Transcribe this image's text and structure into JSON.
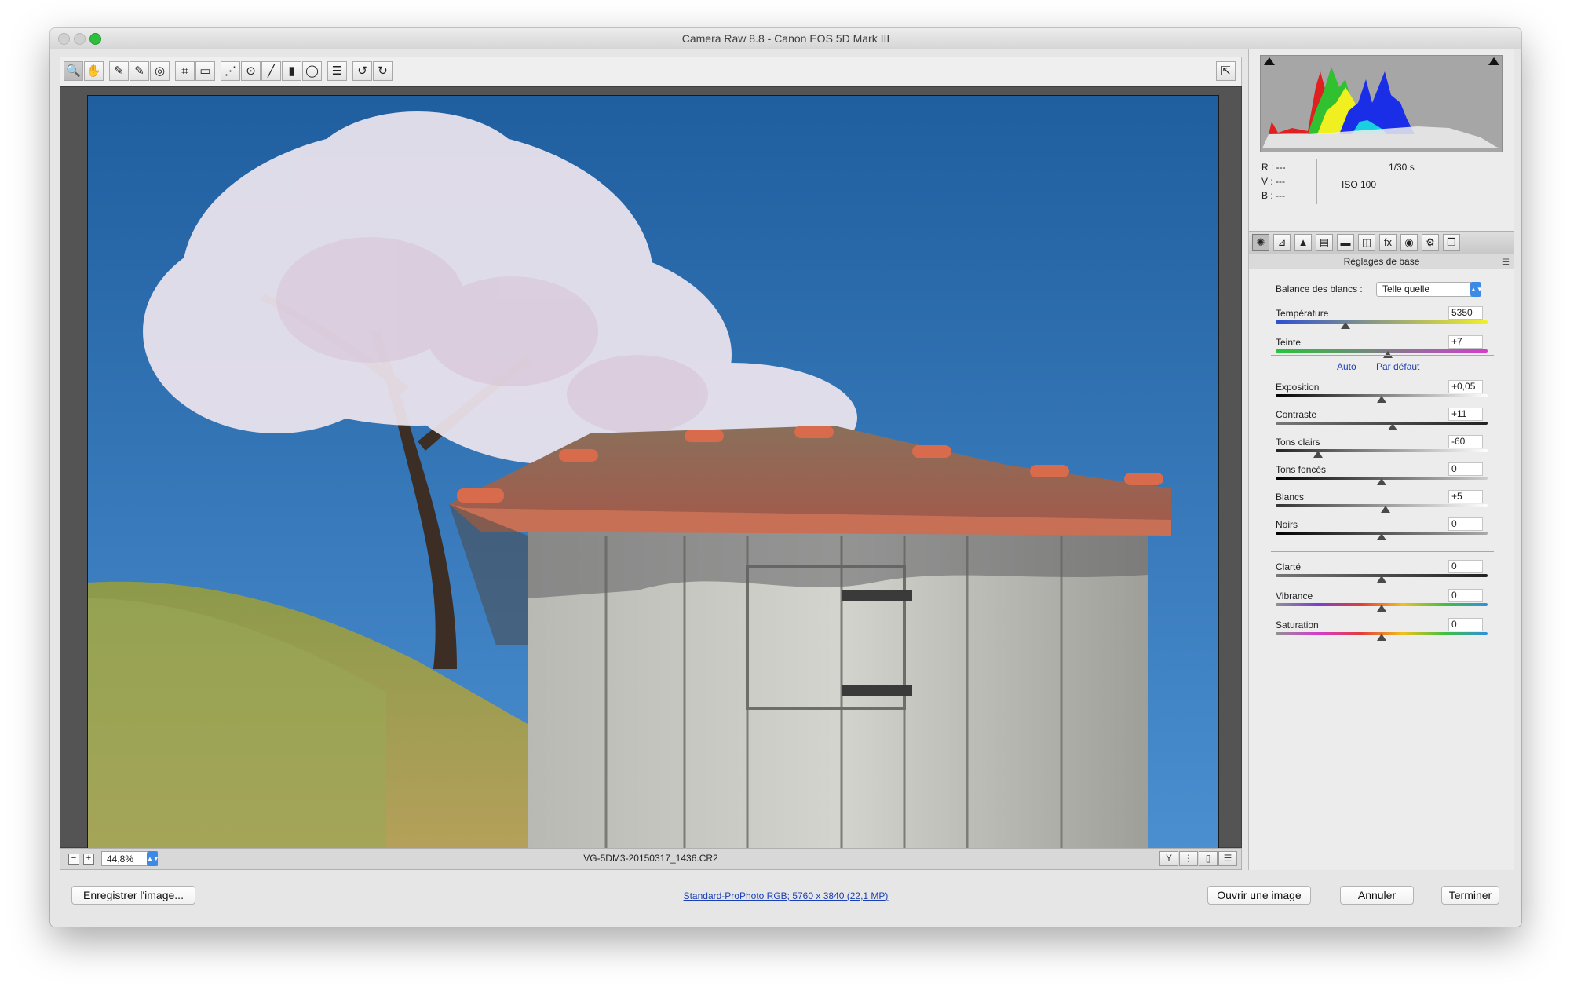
{
  "window": {
    "title": "Camera Raw 8.8  -  Canon EOS 5D Mark III"
  },
  "toolbar": {
    "tools": [
      {
        "name": "zoom-tool-icon",
        "glyph": "🔍"
      },
      {
        "name": "hand-tool-icon",
        "glyph": "✋"
      },
      {
        "name": "white-balance-tool-icon",
        "glyph": "✎"
      },
      {
        "name": "color-sampler-tool-icon",
        "glyph": "✎"
      },
      {
        "name": "targeted-adjustment-tool-icon",
        "glyph": "◎"
      },
      {
        "name": "crop-tool-icon",
        "glyph": "⌗"
      },
      {
        "name": "straighten-tool-icon",
        "glyph": "▭"
      },
      {
        "name": "spot-removal-tool-icon",
        "glyph": "⋰"
      },
      {
        "name": "red-eye-tool-icon",
        "glyph": "⊙"
      },
      {
        "name": "adjustment-brush-icon",
        "glyph": "╱"
      },
      {
        "name": "graduated-filter-icon",
        "glyph": "▮"
      },
      {
        "name": "radial-filter-icon",
        "glyph": "◯"
      },
      {
        "name": "preferences-icon",
        "glyph": "☰"
      },
      {
        "name": "rotate-left-icon",
        "glyph": "↺"
      },
      {
        "name": "rotate-right-icon",
        "glyph": "↻"
      }
    ],
    "fullscreen_icon": "⇱"
  },
  "statusbar": {
    "zoom_out": "−",
    "zoom_in": "+",
    "zoom_value": "44,8%",
    "filename": "VG-5DM3-20150317_1436.CR2",
    "view_tools": [
      "Y",
      "⋮",
      "▯",
      "☰"
    ]
  },
  "histogram": {
    "readout": {
      "r": "R :   ---",
      "v": "V :   ---",
      "b": "B :   ---"
    },
    "shutter": "1/30 s",
    "iso": "ISO 100"
  },
  "panel": {
    "tabs": [
      "✺",
      "⊿",
      "▲",
      "▤",
      "▬",
      "◫",
      "fx",
      "◉",
      "⚙",
      "❐"
    ],
    "section_title": "Réglages de base",
    "wb_label": "Balance des blancs :",
    "wb_value": "Telle quelle",
    "auto": "Auto",
    "default": "Par défaut",
    "sliders": [
      {
        "key": "temperature",
        "label": "Température",
        "value": "5350",
        "pos": 0.33
      },
      {
        "key": "teinte",
        "label": "Teinte",
        "value": "+7",
        "pos": 0.53
      },
      {
        "key": "exposition",
        "label": "Exposition",
        "value": "+0,05",
        "pos": 0.5
      },
      {
        "key": "contraste",
        "label": "Contraste",
        "value": "+11",
        "pos": 0.55
      },
      {
        "key": "tons-clairs",
        "label": "Tons clairs",
        "value": "-60",
        "pos": 0.2
      },
      {
        "key": "tons-fonces",
        "label": "Tons foncés",
        "value": "0",
        "pos": 0.5
      },
      {
        "key": "blancs",
        "label": "Blancs",
        "value": "+5",
        "pos": 0.52
      },
      {
        "key": "noirs",
        "label": "Noirs",
        "value": "0",
        "pos": 0.5
      },
      {
        "key": "clarte",
        "label": "Clarté",
        "value": "0",
        "pos": 0.5
      },
      {
        "key": "vibrance",
        "label": "Vibrance",
        "value": "0",
        "pos": 0.5
      },
      {
        "key": "saturation",
        "label": "Saturation",
        "value": "0",
        "pos": 0.5
      }
    ]
  },
  "bottom": {
    "save": "Enregistrer l'image...",
    "workflow": "Standard-ProPhoto RGB; 5760 x 3840 (22,1 MP)",
    "open": "Ouvrir une image",
    "cancel": "Annuler",
    "done": "Terminer"
  },
  "colors": {
    "sky": "#2f73b8",
    "accent": "#3c8ae6",
    "link": "#1a3fb5"
  }
}
